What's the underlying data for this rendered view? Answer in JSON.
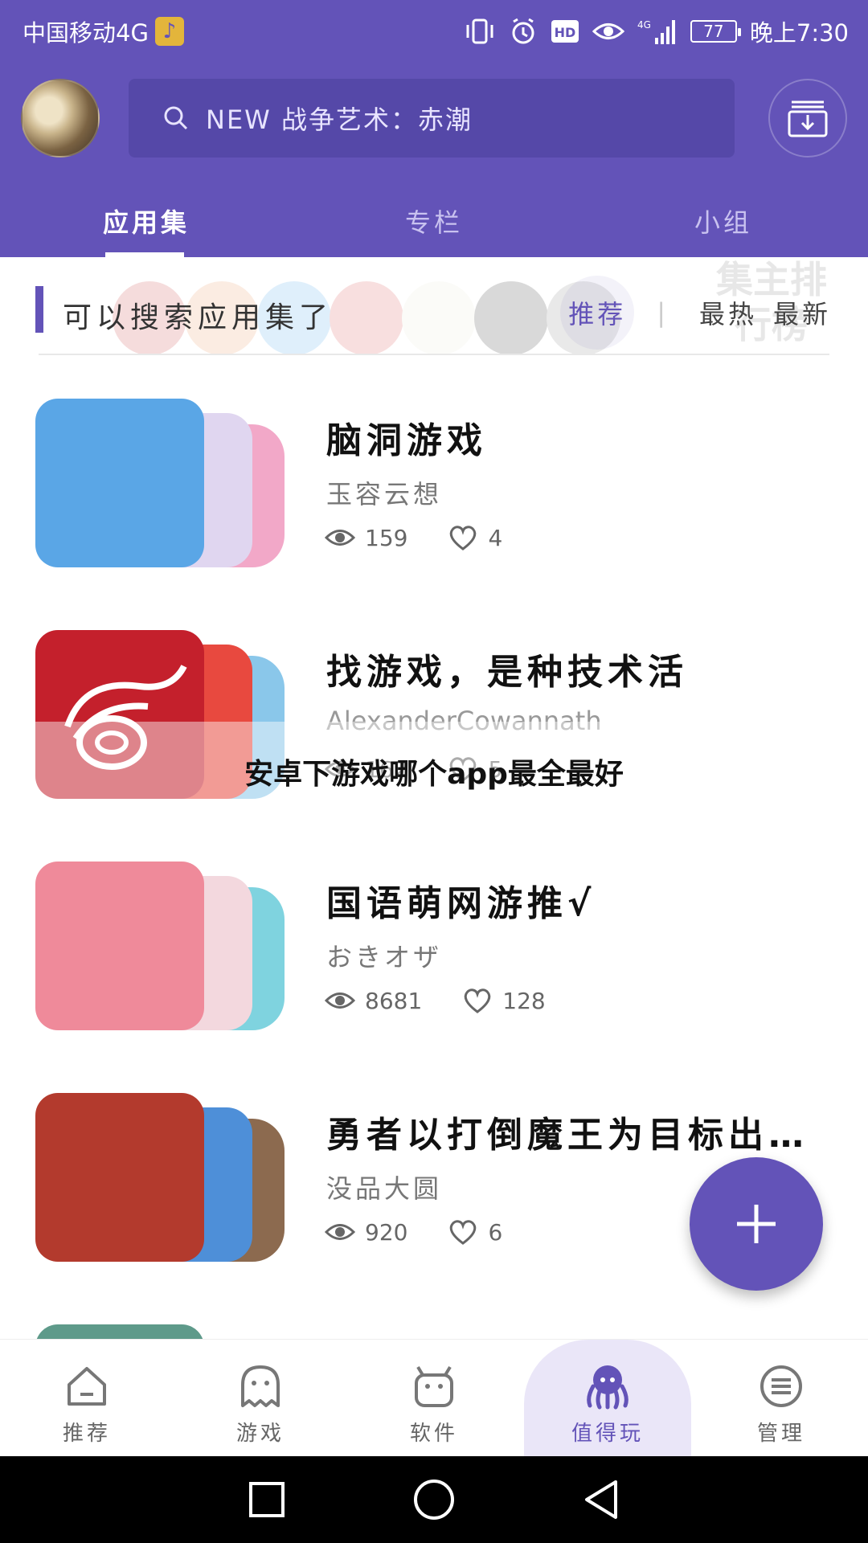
{
  "status_bar": {
    "carrier": "中国移动4G",
    "note_badge": "♪",
    "hd": "HD",
    "net": "4G",
    "battery": "77",
    "time": "晚上7:30"
  },
  "header": {
    "search_placeholder": "NEW 战争艺术：赤潮",
    "tabs": [
      {
        "label": "应用集",
        "active": true
      },
      {
        "label": "专栏",
        "active": false
      },
      {
        "label": "小组",
        "active": false
      }
    ]
  },
  "filter": {
    "title": "可以搜索应用集了",
    "sort": [
      {
        "label": "推荐",
        "active": true
      },
      {
        "label": "最热",
        "active": false
      },
      {
        "label": "最新",
        "active": false
      }
    ],
    "banner_text": "集主排行榜"
  },
  "items": [
    {
      "title": "脑洞游戏",
      "author": "玉容云想",
      "views": "159",
      "likes": "4",
      "colors": [
        "#5aa6e6",
        "#e0d6f0",
        "#f2a8c8"
      ]
    },
    {
      "title": "找游戏，是种技术活",
      "author": "AlexanderCowannath",
      "views": "162",
      "likes": "5",
      "colors": [
        "#c4202c",
        "#e8493f",
        "#8ac7ea"
      ]
    },
    {
      "title": "国语萌网游推√",
      "author": "おきオザ",
      "views": "8681",
      "likes": "128",
      "colors": [
        "#ef8a9a",
        "#f3d8de",
        "#7fd3df"
      ]
    },
    {
      "title": "勇者以打倒魔王为目标出…",
      "author": "没品大圆",
      "views": "920",
      "likes": "6",
      "colors": [
        "#b33a2d",
        "#4e8fd8",
        "#8c6a4f"
      ]
    }
  ],
  "watermark": "安卓下游戏哪个app最全最好",
  "bottom_nav": [
    {
      "label": "推荐",
      "icon": "home-icon",
      "active": false
    },
    {
      "label": "游戏",
      "icon": "ghost-icon",
      "active": false
    },
    {
      "label": "软件",
      "icon": "android-icon",
      "active": false
    },
    {
      "label": "值得玩",
      "icon": "octopus-icon",
      "active": true
    },
    {
      "label": "管理",
      "icon": "menu-icon",
      "active": false
    }
  ],
  "colors": {
    "brand": "#6353b8",
    "brand_dark": "#5548a8"
  }
}
